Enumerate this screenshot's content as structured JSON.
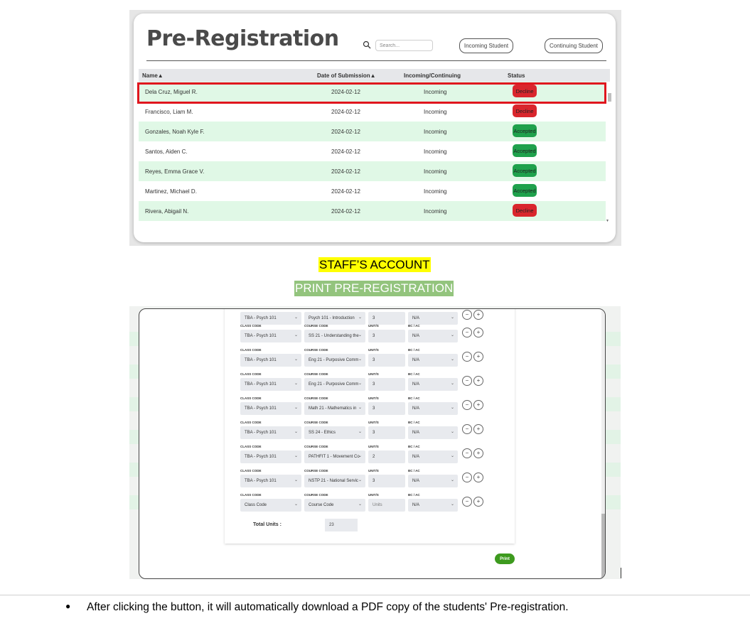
{
  "shot1": {
    "title": "Pre-Registration",
    "search_placeholder": "Search...",
    "btn_incoming": "Incoming Student",
    "btn_continuing": "Continuing Student",
    "columns": {
      "name": "Name▲",
      "date": "Date of Submission▲",
      "type": "Incoming/Continuing",
      "status": "Status"
    },
    "rows": [
      {
        "name": "Dela Cruz, Miguel R.",
        "date": "2024-02-12",
        "type": "Incoming",
        "status": "Decline"
      },
      {
        "name": "Francisco, Liam M.",
        "date": "2024-02-12",
        "type": "Incoming",
        "status": "Decline"
      },
      {
        "name": "Gonzales, Noah Kyle F.",
        "date": "2024-02-12",
        "type": "Incoming",
        "status": "Accepted"
      },
      {
        "name": "Santos, Aiden C.",
        "date": "2024-02-12",
        "type": "Incoming",
        "status": "Accepted"
      },
      {
        "name": "Reyes, Emma Grace V.",
        "date": "2024-02-12",
        "type": "Incoming",
        "status": "Accepted"
      },
      {
        "name": "Martinez, Michael D.",
        "date": "2024-02-12",
        "type": "Incoming",
        "status": "Accepted"
      },
      {
        "name": "Rivera, Abigail N.",
        "date": "2024-02-12",
        "type": "Incoming",
        "status": "Decline"
      }
    ],
    "colors": {
      "decline": "#d9262d",
      "accepted": "#1fa14c",
      "highlight": "#e0161e",
      "row_alt": "#e0f8e6"
    }
  },
  "captions": {
    "staff": "STAFF’S ACCOUNT",
    "print": "PRINT PRE-REGISTRATION"
  },
  "shot2": {
    "labels": {
      "class": "CLASS CODE",
      "course": "COURSE CODE",
      "units": "UNIT/S",
      "bcac": "BC / AC"
    },
    "rows": [
      {
        "class": "TBA - Psych 101",
        "course": "Psych 101 - Introduction",
        "units": "3",
        "bcac": "N/A"
      },
      {
        "class": "TBA - Psych 101",
        "course": "SS 21 - Understanding the",
        "units": "3",
        "bcac": "N/A"
      },
      {
        "class": "TBA - Psych 101",
        "course": "Eng 21 - Purposive Comm",
        "units": "3",
        "bcac": "N/A"
      },
      {
        "class": "TBA - Psych 101",
        "course": "Eng 21 - Purposive Comm",
        "units": "3",
        "bcac": "N/A"
      },
      {
        "class": "TBA - Psych 101",
        "course": "Math 21 - Mathematics in",
        "units": "3",
        "bcac": "N/A"
      },
      {
        "class": "TBA - Psych 101",
        "course": "SS 24 - Ethics",
        "units": "3",
        "bcac": "N/A"
      },
      {
        "class": "TBA - Psych 101",
        "course": "PATHFIT 1 - Movement Co",
        "units": "2",
        "bcac": "N/A"
      },
      {
        "class": "TBA - Psych 101",
        "course": "NSTP 21 - National Servic",
        "units": "3",
        "bcac": "N/A"
      }
    ],
    "empty_row": {
      "class": "Class Code",
      "course": "Course Code",
      "units": "Units",
      "bcac": "N/A"
    },
    "total_label": "Total Units :",
    "total_value": "23",
    "print_label": "Print",
    "print_color": "#3d9a1e",
    "minus": "−",
    "plus": "+"
  },
  "note": {
    "bullet": "●",
    "text": "After clicking the button, it will automatically download a PDF copy of the students' Pre-registration."
  }
}
